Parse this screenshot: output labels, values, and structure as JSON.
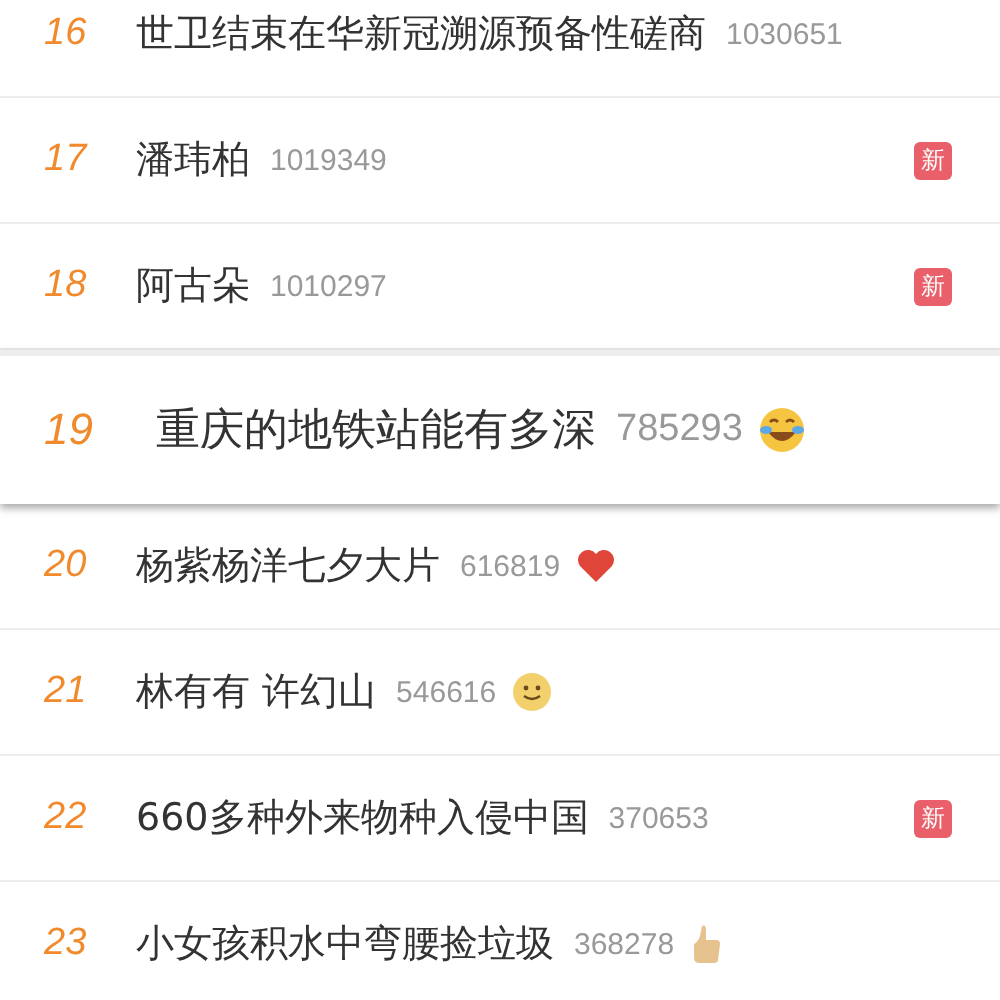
{
  "hot_list": [
    {
      "rank": "16",
      "title": "世卫结束在华新冠溯源预备性磋商",
      "count": "1030651",
      "highlighted": false
    },
    {
      "rank": "17",
      "title": "潘玮柏",
      "count": "1019349",
      "highlighted": false,
      "mark": {
        "kind": "badge",
        "text": "新"
      }
    },
    {
      "rank": "18",
      "title": "阿古朵",
      "count": "1010297",
      "highlighted": false,
      "mark": {
        "kind": "badge",
        "text": "新"
      }
    },
    {
      "rank": "19",
      "title": "重庆的地铁站能有多深",
      "count": "785293",
      "highlighted": true,
      "mark": {
        "kind": "laugh"
      }
    },
    {
      "rank": "20",
      "title": "杨紫杨洋七夕大片",
      "count": "616819",
      "highlighted": false,
      "mark": {
        "kind": "heart"
      }
    },
    {
      "rank": "21",
      "title": "林有有 许幻山",
      "count": "546616",
      "highlighted": false,
      "mark": {
        "kind": "smile"
      }
    },
    {
      "rank": "22",
      "title": "660多种外来物种入侵中国",
      "count": "370653",
      "highlighted": false,
      "mark": {
        "kind": "badge",
        "text": "新"
      }
    },
    {
      "rank": "23",
      "title": "小女孩积水中弯腰捡垃圾",
      "count": "368278",
      "highlighted": false,
      "mark": {
        "kind": "thumbs"
      }
    }
  ]
}
